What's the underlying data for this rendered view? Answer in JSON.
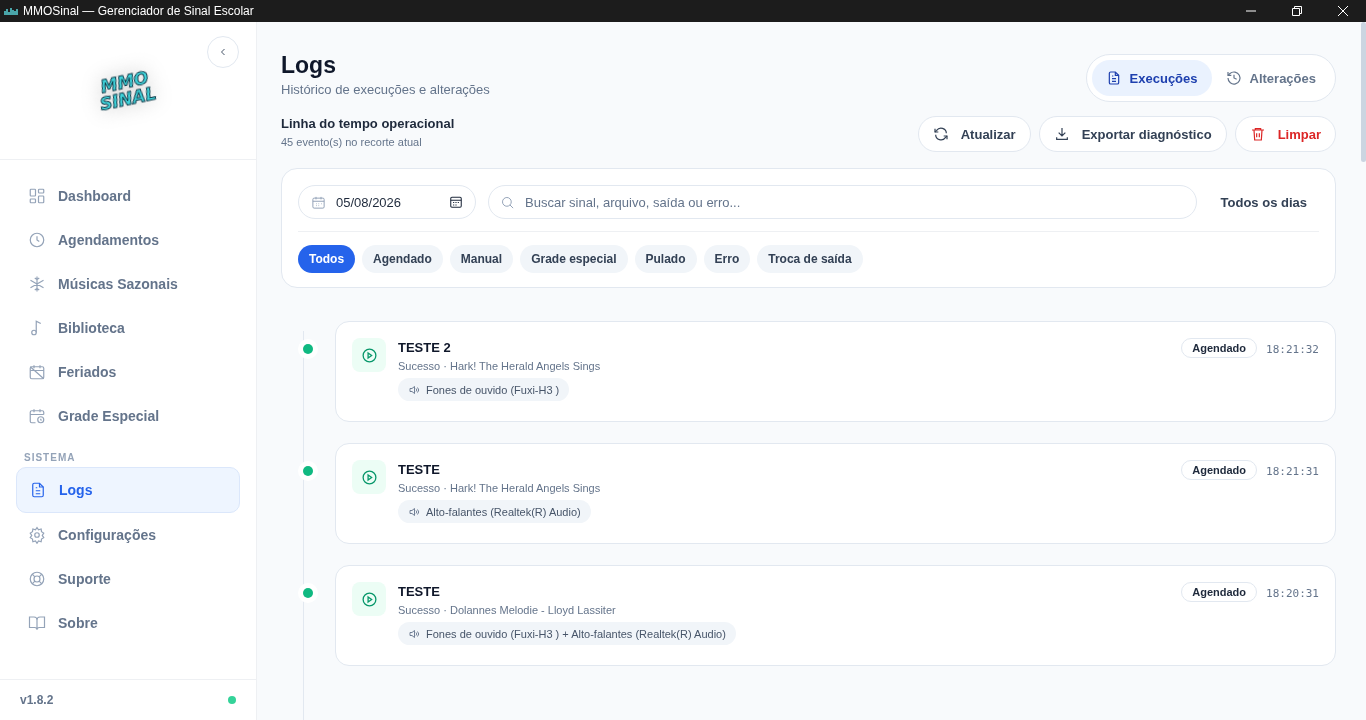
{
  "window": {
    "title": "MMOSinal — Gerenciador de Sinal Escolar"
  },
  "sidebar": {
    "logo": [
      "MMO",
      "SINAL"
    ],
    "items": [
      {
        "label": "Dashboard",
        "selected": false
      },
      {
        "label": "Agendamentos",
        "selected": false
      },
      {
        "label": "Músicas Sazonais",
        "selected": false
      },
      {
        "label": "Biblioteca",
        "selected": false
      },
      {
        "label": "Feriados",
        "selected": false
      },
      {
        "label": "Grade Especial",
        "selected": false
      }
    ],
    "section": "SISTEMA",
    "system_items": [
      {
        "label": "Logs",
        "selected": true
      },
      {
        "label": "Configurações",
        "selected": false
      },
      {
        "label": "Suporte",
        "selected": false
      },
      {
        "label": "Sobre",
        "selected": false
      }
    ],
    "version": "v1.8.2",
    "online": true
  },
  "header": {
    "title": "Logs",
    "subtitle": "Histórico de execuções e alterações",
    "tabs": [
      {
        "label": "Execuções",
        "selected": true
      },
      {
        "label": "Alterações",
        "selected": false
      }
    ]
  },
  "timeline": {
    "title": "Linha do tempo operacional",
    "count": "45 evento(s) no recorte atual",
    "actions": [
      {
        "label": "Atualizar",
        "kind": "refresh"
      },
      {
        "label": "Exportar diagnóstico",
        "kind": "export"
      },
      {
        "label": "Limpar",
        "kind": "danger"
      }
    ]
  },
  "filters": {
    "date": "05/08/2026",
    "search_placeholder": "Buscar sinal, arquivo, saída ou erro...",
    "all_days": "Todos os dias",
    "chips": [
      {
        "label": "Todos",
        "selected": true
      },
      {
        "label": "Agendado",
        "selected": false
      },
      {
        "label": "Manual",
        "selected": false
      },
      {
        "label": "Grade especial",
        "selected": false
      },
      {
        "label": "Pulado",
        "selected": false
      },
      {
        "label": "Erro",
        "selected": false
      },
      {
        "label": "Troca de saída",
        "selected": false
      }
    ]
  },
  "events": [
    {
      "title": "TESTE 2",
      "detail": "Sucesso · Hark! The Herald Angels Sings",
      "output": "Fones de ouvido (Fuxi-H3 )",
      "tag": "Agendado",
      "time": "18:21:32",
      "color": "#10b981"
    },
    {
      "title": "TESTE",
      "detail": "Sucesso · Hark! The Herald Angels Sings",
      "output": "Alto-falantes (Realtek(R) Audio)",
      "tag": "Agendado",
      "time": "18:21:31",
      "color": "#10b981"
    },
    {
      "title": "TESTE",
      "detail": "Sucesso · Dolannes Melodie - Lloyd Lassiter",
      "output": "Fones de ouvido (Fuxi-H3 ) + Alto-falantes (Realtek(R) Audio)",
      "tag": "Agendado",
      "time": "18:20:31",
      "color": "#10b981"
    }
  ]
}
